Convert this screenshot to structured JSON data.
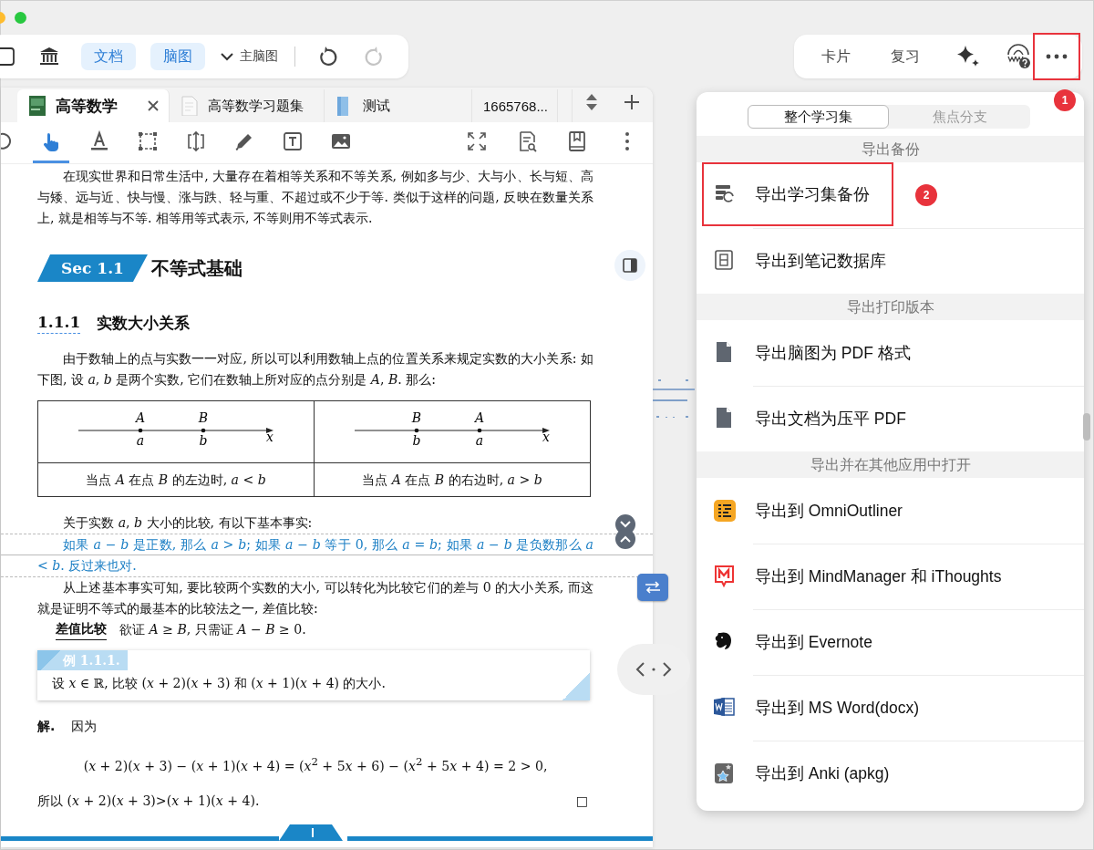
{
  "window": {
    "traffic_lights": [
      {
        "color": "#febc2e"
      },
      {
        "color": "#28c840"
      }
    ]
  },
  "left_toolbar": {
    "toggles": [
      {
        "label": "文档",
        "on": true
      },
      {
        "label": "脑图",
        "on": true
      }
    ],
    "mindmap_select": {
      "value": "主脑图"
    },
    "undo": {
      "disabled": false
    },
    "redo": {
      "disabled": true
    }
  },
  "right_toolbar": {
    "buttons": [
      {
        "label": "卡片"
      },
      {
        "label": "复习"
      }
    ],
    "more_button": {
      "annotation": "1"
    }
  },
  "document": {
    "tabs": [
      {
        "title": "高等数学",
        "selected": true,
        "closable": true
      },
      {
        "title": "高等数学习题集",
        "selected": false,
        "closable": false
      },
      {
        "title": "测试",
        "selected": false,
        "closable": false
      },
      {
        "title": "1665768...",
        "selected": false,
        "closable": false
      }
    ],
    "tools": [
      {
        "selected": false
      },
      {
        "selected": true
      },
      {
        "selected": false
      },
      {
        "selected": false
      },
      {
        "selected": false
      },
      {
        "selected": false
      },
      {
        "selected": false
      },
      {
        "selected": false
      }
    ],
    "blocks": [
      {
        "kind": "paragraph",
        "text": "在现实世界和日常生活中, 大量存在着相等关系和不等关系, 例如多与少、大与小、长与短、高与矮、远与近、快与慢、涨与跌、轻与重、不超过或不少于等. 类似于这样的问题, 反映在数量关系上, 就是相等与不等. 相等用等式表示, 不等则用不等式表示."
      },
      {
        "kind": "section",
        "badge": "Sec 1.1",
        "title": "不等式基础"
      },
      {
        "kind": "subsection",
        "number": "1.1.1",
        "title": "实数大小关系"
      },
      {
        "kind": "paragraph",
        "text": "由于数轴上的点与实数一一对应, 所以可以利用数轴上点的位置关系来规定实数的大小关系: 如下图, 设 *a*, *b* 是两个实数, 它们在数轴上所对应的点分别是 *A*, *B*. 那么:"
      },
      {
        "kind": "number_line_table",
        "columns": [
          {
            "points": [
              {
                "upper": "A",
                "lower": "a"
              },
              {
                "upper": "B",
                "lower": "b"
              }
            ],
            "axis": "x",
            "caption": "当点 *A* 在点 *B* 的左边时, *a* < *b*"
          },
          {
            "points": [
              {
                "upper": "B",
                "lower": "b"
              },
              {
                "upper": "A",
                "lower": "a"
              }
            ],
            "axis": "x",
            "caption": "当点 *A* 在点 *B* 的右边时, *a* > *b*"
          }
        ]
      },
      {
        "kind": "paragraph",
        "text": "关于实数 *a*, *b* 大小的比较, 有以下基本事实:"
      },
      {
        "kind": "highlight",
        "text": "如果 *a* − *b* 是正数, 那么 *a* > *b*; 如果 *a* − *b* 等于 0, 那么 *a* = *b*; 如果 *a* − *b* 是负数那么 *a* < *b*. 反过来也对."
      },
      {
        "kind": "paragraph",
        "text": "从上述基本事实可知, 要比较两个实数的大小, 可以转化为比较它们的差与 0 的大小关系, 而这就是证明不等式的最基本的比较法之一, 差值比较:"
      },
      {
        "kind": "definition",
        "term": "差值比较",
        "text": "欲证 *A* ≥ *B*, 只需证 *A* − *B* ≥ 0."
      },
      {
        "kind": "example",
        "label": "例 1.1.1.",
        "text": "设 *x* ∈ ℝ, 比较 (*x* + 2)(*x* + 3) 和 (*x* + 1)(*x* + 4) 的大小."
      },
      {
        "kind": "solution",
        "term": "解.",
        "text": "因为"
      },
      {
        "kind": "equation",
        "text": "(*x* + 2)(*x* + 3) − (*x* + 1)(*x* + 4) = (*x*$^{2}$ + 5𝑥 + 6) − (*x*$^{2}$ + 5𝑥 + 4) = 2 > 0,"
      },
      {
        "kind": "conclusion",
        "text": "所以 (*x* + 2)(*x* + 3)>(*x* + 1)(*x* + 4).",
        "qed": "□"
      }
    ]
  },
  "export_menu": {
    "segments": [
      {
        "label": "整个学习集",
        "selected": true
      },
      {
        "label": "焦点分支",
        "selected": false
      }
    ],
    "sections": [
      {
        "header": "导出备份",
        "items": [
          {
            "label": "导出学习集备份",
            "annotation": "2"
          },
          {
            "label": "导出到笔记数据库"
          }
        ]
      },
      {
        "header": "导出打印版本",
        "items": [
          {
            "label": "导出脑图为 PDF 格式"
          },
          {
            "label": "导出文档为压平 PDF"
          }
        ]
      },
      {
        "header": "导出并在其他应用中打开",
        "items": [
          {
            "label": "导出到 OmniOutliner"
          },
          {
            "label": "导出到 MindManager 和 iThoughts"
          },
          {
            "label": "导出到 Evernote"
          },
          {
            "label": "导出到 MS Word(docx)"
          },
          {
            "label": "导出到 Anki (apkg)"
          }
        ]
      }
    ]
  }
}
